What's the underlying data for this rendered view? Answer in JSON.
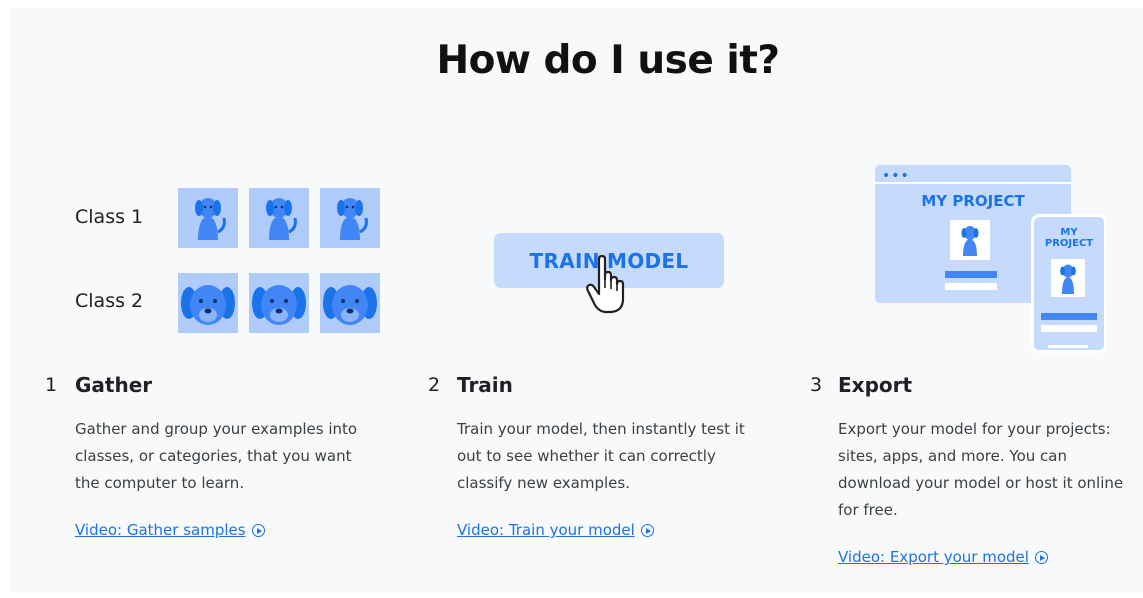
{
  "title": "How do I use it?",
  "gather_visual": {
    "class1_label": "Class 1",
    "class2_label": "Class 2"
  },
  "train_visual": {
    "button_label": "TRAIN MODEL"
  },
  "export_visual": {
    "window_dots": "•••",
    "window_title": "MY PROJECT",
    "phone_title_line1": "MY",
    "phone_title_line2": "PROJECT"
  },
  "steps": [
    {
      "number": "1",
      "title": "Gather",
      "description": "Gather and group your examples into classes, or categories, that you want the computer to learn.",
      "link": "Video: Gather samples"
    },
    {
      "number": "2",
      "title": "Train",
      "description": "Train your model, then instantly test it out to see whether it can correctly classify new examples.",
      "link": "Video: Train your model"
    },
    {
      "number": "3",
      "title": "Export",
      "description": "Export your model for your projects: sites, apps, and more. You can download your model or host it online for free.",
      "link": "Video: Export your model"
    }
  ],
  "colors": {
    "accent": "#1a73e8",
    "tile_bg": "#aecbfa",
    "light_blue": "#c6dafc",
    "panel_bg": "#f8f9fa"
  },
  "icons": [
    "dog-sitting-icon",
    "dog-face-icon",
    "hand-pointer-icon",
    "play-circle-icon"
  ]
}
